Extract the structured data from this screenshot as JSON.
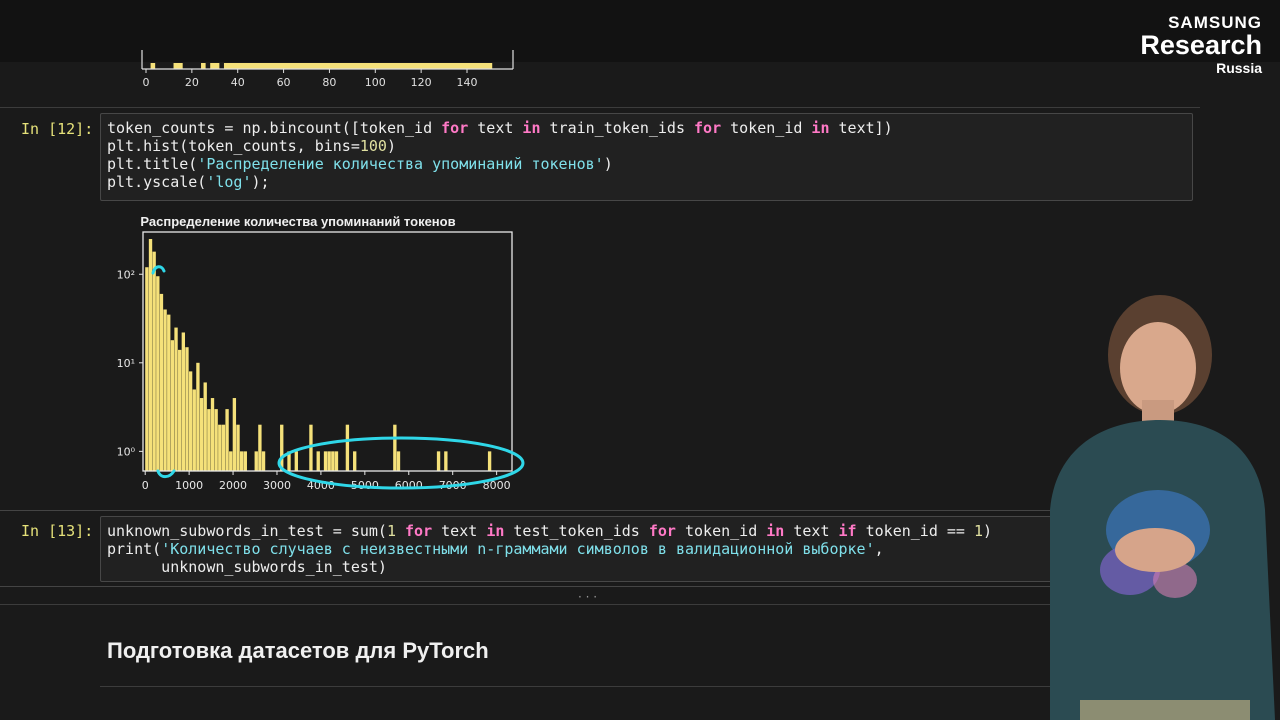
{
  "brand": {
    "line1": "SAMSUNG",
    "line2": "Research",
    "line3": "Russia"
  },
  "prev_chart": {
    "x_ticks": [
      "0",
      "20",
      "40",
      "60",
      "80",
      "100",
      "120",
      "140"
    ]
  },
  "cell12": {
    "prompt": "In [12]:",
    "code": [
      "token_counts = np.bincount([token_id for text in train_token_ids for token_id in text])",
      "plt.hist(token_counts, bins=100)",
      "plt.title('Распределение количества упоминаний токенов')",
      "plt.yscale('log');"
    ]
  },
  "chart_data": {
    "type": "bar",
    "title": "Распределение количества упоминаний токенов",
    "xlabel": "",
    "ylabel": "",
    "yscale": "log",
    "xlim": [
      -50,
      8350
    ],
    "ylim": [
      0.6,
      300
    ],
    "x_ticks": [
      "0",
      "1000",
      "2000",
      "3000",
      "4000",
      "5000",
      "6000",
      "7000",
      "8000"
    ],
    "y_ticks": [
      "10⁰",
      "10¹",
      "10²"
    ],
    "bin_width": 83,
    "bins_x": [
      0,
      83,
      166,
      249,
      332,
      415,
      498,
      581,
      664,
      747,
      830,
      913,
      996,
      1079,
      1162,
      1245,
      1328,
      1411,
      1494,
      1577,
      1660,
      1743,
      1826,
      1909,
      1992,
      2075,
      2158,
      2241,
      2490,
      2573,
      2656,
      3070,
      3236,
      3402,
      3735,
      3901,
      4067,
      4150,
      4233,
      4316,
      4565,
      4731,
      5645,
      5728,
      6640,
      6806,
      7802
    ],
    "counts": [
      120,
      250,
      180,
      95,
      60,
      40,
      35,
      18,
      25,
      14,
      22,
      15,
      8,
      5,
      10,
      4,
      6,
      3,
      4,
      3,
      2,
      2,
      3,
      1,
      4,
      2,
      1,
      1,
      1,
      2,
      1,
      2,
      1,
      1,
      2,
      1,
      1,
      1,
      1,
      1,
      2,
      1,
      2,
      1,
      1,
      1,
      1
    ]
  },
  "cell13": {
    "prompt": "In [13]:",
    "code": [
      "unknown_subwords_in_test = sum(1 for text in test_token_ids for token_id in text if token_id == 1)",
      "print('Количество случаев с неизвестными n-граммами символов в валидационной выборке',",
      "      unknown_subwords_in_test)"
    ]
  },
  "ellipsis": "· · ·",
  "section_heading": "Подготовка датасетов для PyTorch",
  "colors": {
    "bar": "#f5e17a",
    "annotation": "#2fd7e8",
    "background": "#1a1a1a"
  }
}
